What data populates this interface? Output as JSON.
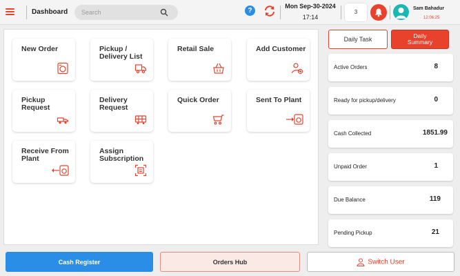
{
  "header": {
    "title": "Dashboard",
    "search_placeholder": "Search",
    "help_symbol": "?",
    "date": "Mon Sep-30-2024",
    "time": "17:14",
    "notification_count": "3",
    "user_name": "Sam Bahadur",
    "user_time": "12:06:25"
  },
  "tiles": [
    {
      "label": "New Order",
      "icon": "washing-machine-icon"
    },
    {
      "label": "Pickup / Delivery List",
      "icon": "delivery-truck-icon"
    },
    {
      "label": "Retail Sale",
      "icon": "shopping-basket-icon"
    },
    {
      "label": "Add Customer",
      "icon": "add-user-icon"
    },
    {
      "label": "Pickup Request",
      "icon": "pickup-truck-icon"
    },
    {
      "label": "Delivery Request",
      "icon": "delivery-van-icon"
    },
    {
      "label": "Quick Order",
      "icon": "shopping-cart-icon"
    },
    {
      "label": "Sent To Plant",
      "icon": "send-to-plant-icon"
    },
    {
      "label": "Receive From Plant",
      "icon": "receive-from-plant-icon"
    },
    {
      "label": "Assign Subscription",
      "icon": "subscription-icon"
    }
  ],
  "right_panel": {
    "daily_task_label": "Daily Task",
    "daily_summary_line1": "Daily",
    "daily_summary_line2": "Summary",
    "stats": [
      {
        "label": "Active Orders",
        "value": "8"
      },
      {
        "label": "Ready for pickup/delivery",
        "value": "0"
      },
      {
        "label": "Cash Collected",
        "value": "1851.99"
      },
      {
        "label": "Unpaid Order",
        "value": "1"
      },
      {
        "label": "Due Balance",
        "value": "119"
      },
      {
        "label": "Pending Pickup",
        "value": "21"
      }
    ]
  },
  "footer": {
    "cash_register_label": "Cash Register",
    "orders_hub_label": "Orders Hub",
    "switch_user_label": "Switch User"
  },
  "colors": {
    "accent": "#e8412c",
    "primary_blue": "#2a8de6",
    "avatar": "#19b9b2"
  }
}
